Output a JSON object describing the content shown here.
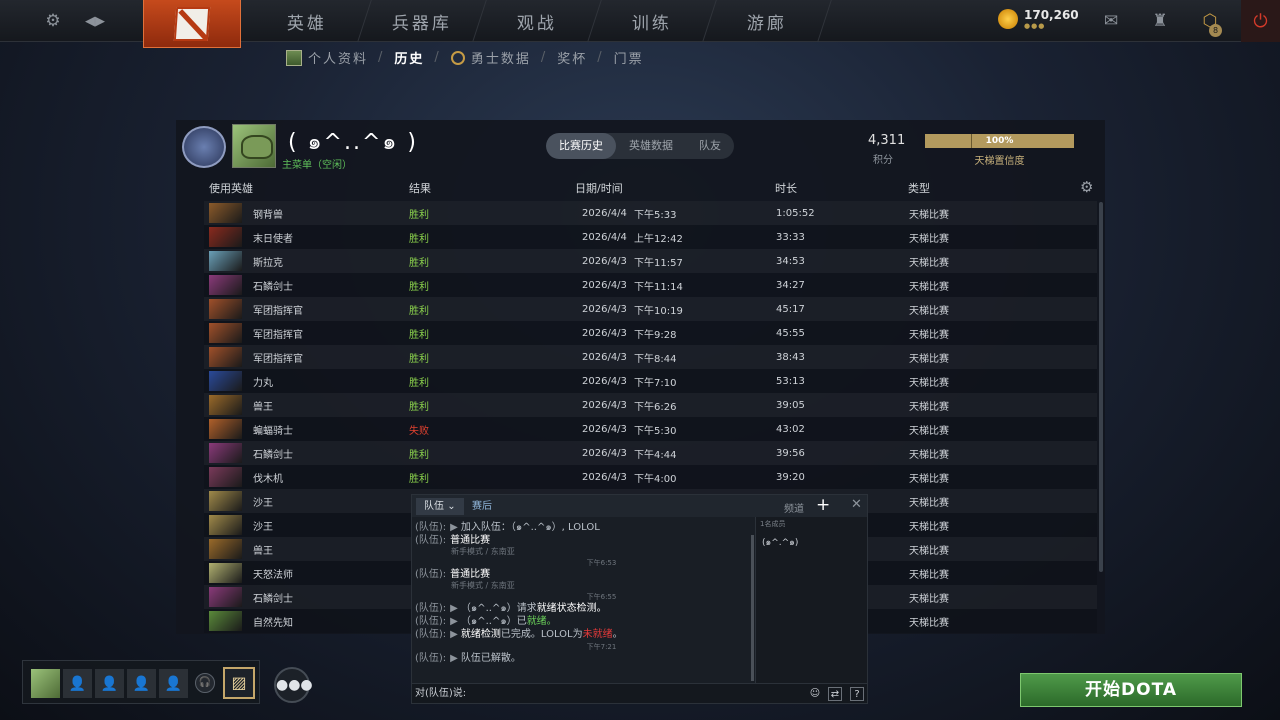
{
  "topbar": {
    "nav": [
      "英雄",
      "兵器库",
      "观战",
      "训练",
      "游廊"
    ],
    "currency": "170,260",
    "currency_dots": "●●●",
    "badge_level": "8"
  },
  "subnav": {
    "items": [
      {
        "label": "个人资料",
        "active": false
      },
      {
        "label": "历史",
        "active": true
      },
      {
        "label": "勇士数据",
        "active": false
      },
      {
        "label": "奖杯",
        "active": false
      },
      {
        "label": "门票",
        "active": false
      }
    ]
  },
  "profile": {
    "name": "( ๑^..^๑ )",
    "sub": "主菜单（空闲）",
    "tabs": [
      "比赛历史",
      "英雄数据",
      "队友"
    ],
    "mmr": "4,311",
    "mmr_label": "积分",
    "confidence": "100%",
    "confidence_value": 100,
    "confidence_label": "天梯置信度"
  },
  "table": {
    "headers": {
      "hero": "使用英雄",
      "result": "结果",
      "date": "日期/时间",
      "duration": "时长",
      "type": "类型"
    },
    "rows": [
      {
        "hero": "钢背兽",
        "result": "胜利",
        "win": true,
        "date": "2026/4/4",
        "time": "下午5:33",
        "duration": "1:05:52",
        "type": "天梯比赛",
        "color": "#8b5a2a"
      },
      {
        "hero": "末日使者",
        "result": "胜利",
        "win": true,
        "date": "2026/4/4",
        "time": "上午12:42",
        "duration": "33:33",
        "type": "天梯比赛",
        "color": "#8a2a1e"
      },
      {
        "hero": "斯拉克",
        "result": "胜利",
        "win": true,
        "date": "2026/4/3",
        "time": "下午11:57",
        "duration": "34:53",
        "type": "天梯比赛",
        "color": "#6aa0b8"
      },
      {
        "hero": "石鳞剑士",
        "result": "胜利",
        "win": true,
        "date": "2026/4/3",
        "time": "下午11:14",
        "duration": "34:27",
        "type": "天梯比赛",
        "color": "#8a3a7a"
      },
      {
        "hero": "军团指挥官",
        "result": "胜利",
        "win": true,
        "date": "2026/4/3",
        "time": "下午10:19",
        "duration": "45:17",
        "type": "天梯比赛",
        "color": "#a0502a"
      },
      {
        "hero": "军团指挥官",
        "result": "胜利",
        "win": true,
        "date": "2026/4/3",
        "time": "下午9:28",
        "duration": "45:55",
        "type": "天梯比赛",
        "color": "#a0502a"
      },
      {
        "hero": "军团指挥官",
        "result": "胜利",
        "win": true,
        "date": "2026/4/3",
        "time": "下午8:44",
        "duration": "38:43",
        "type": "天梯比赛",
        "color": "#a0502a"
      },
      {
        "hero": "力丸",
        "result": "胜利",
        "win": true,
        "date": "2026/4/3",
        "time": "下午7:10",
        "duration": "53:13",
        "type": "天梯比赛",
        "color": "#2a4a9a"
      },
      {
        "hero": "兽王",
        "result": "胜利",
        "win": true,
        "date": "2026/4/3",
        "time": "下午6:26",
        "duration": "39:05",
        "type": "天梯比赛",
        "color": "#9a6a2a"
      },
      {
        "hero": "蝙蝠骑士",
        "result": "失败",
        "win": false,
        "date": "2026/4/3",
        "time": "下午5:30",
        "duration": "43:02",
        "type": "天梯比赛",
        "color": "#b0602a"
      },
      {
        "hero": "石鳞剑士",
        "result": "胜利",
        "win": true,
        "date": "2026/4/3",
        "time": "下午4:44",
        "duration": "39:56",
        "type": "天梯比赛",
        "color": "#8a3a7a"
      },
      {
        "hero": "伐木机",
        "result": "胜利",
        "win": true,
        "date": "2026/4/3",
        "time": "下午4:00",
        "duration": "39:20",
        "type": "天梯比赛",
        "color": "#7a3a5a"
      },
      {
        "hero": "沙王",
        "result": "",
        "win": true,
        "date": "",
        "time": "",
        "duration": "",
        "type": "天梯比赛",
        "color": "#a08a4a"
      },
      {
        "hero": "沙王",
        "result": "",
        "win": true,
        "date": "",
        "time": "",
        "duration": "",
        "type": "天梯比赛",
        "color": "#a08a4a"
      },
      {
        "hero": "兽王",
        "result": "",
        "win": true,
        "date": "",
        "time": "",
        "duration": "",
        "type": "天梯比赛",
        "color": "#9a6a2a"
      },
      {
        "hero": "天怒法师",
        "result": "",
        "win": true,
        "date": "",
        "time": "",
        "duration": "",
        "type": "天梯比赛",
        "color": "#b0b070"
      },
      {
        "hero": "石鳞剑士",
        "result": "",
        "win": true,
        "date": "",
        "time": "",
        "duration": "",
        "type": "天梯比赛",
        "color": "#8a3a7a"
      },
      {
        "hero": "自然先知",
        "result": "",
        "win": true,
        "date": "",
        "time": "",
        "duration": "",
        "type": "天梯比赛",
        "color": "#5a8a3a"
      }
    ]
  },
  "chat": {
    "tab_active": "队伍",
    "tab_second": "赛后",
    "channel_label": "频道",
    "member_count": "1名成员",
    "member": "(๑^.^๑)",
    "who": "(队伍):",
    "join_line": "加入队伍：（๑^..^๑）, LOLOL",
    "match1": "普通比赛",
    "match1_sub": "新手模式 / 东南亚",
    "match2": "普通比赛",
    "match2_sub": "新手模式 / 东南亚",
    "time1": "下午6:53",
    "time2": "下午6:55",
    "time3": "下午7:21",
    "ready_req_name": "（๑^..^๑）",
    "ready_req_mid": "请求",
    "ready_req_end": "就绪状态检测。",
    "ready_name": "（๑^..^๑）",
    "ready_mid": "已",
    "ready_end": "就绪。",
    "check_a": "就绪检测",
    "check_b": "已完成。LOLOL为",
    "check_c": "未就绪",
    "check_d": "。",
    "disband": "队伍已解散。",
    "input_prompt": "对(队伍)说:"
  },
  "bottom": {
    "play_label": "开始DOTA"
  }
}
